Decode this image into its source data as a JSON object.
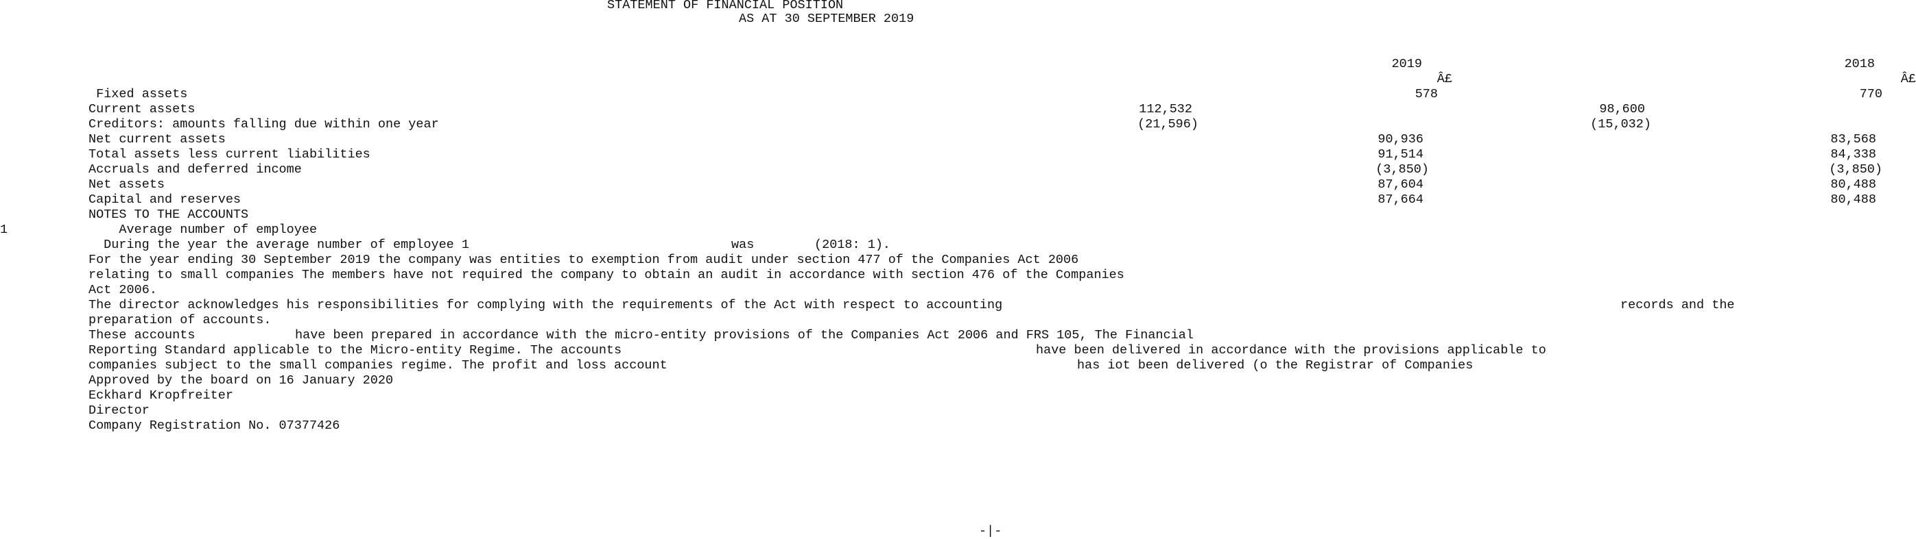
{
  "header": {
    "title": "STATEMENT OF FINANCIAL POSITION",
    "subtitle": "AS AT 30 SEPTEMBER 2019"
  },
  "balance_sheet": {
    "columns": {
      "current_year": "2019",
      "prior_year": "2018",
      "currency_current": "Â£",
      "currency_prior": "Â£"
    },
    "rows": [
      {
        "label": " Fixed assets",
        "sub_2019": "",
        "total_2019": "578",
        "sub_2018": "",
        "total_2018": "770"
      },
      {
        "label": "Current assets",
        "sub_2019": "112,532",
        "total_2019": "",
        "sub_2018": "98,600",
        "total_2018": ""
      },
      {
        "label": "Creditors: amounts falling due within one year",
        "sub_2019": "(21,596)",
        "total_2019": "",
        "sub_2018": "(15,032)",
        "total_2018": ""
      },
      {
        "label": "Net current assets",
        "sub_2019": "",
        "total_2019": "90,936",
        "sub_2018": "",
        "total_2018": "83,568"
      },
      {
        "label": "Total assets less current liabilities",
        "sub_2019": "",
        "total_2019": "91,514",
        "sub_2018": "",
        "total_2018": "84,338"
      },
      {
        "label": "Accruals and deferred income",
        "sub_2019": "",
        "total_2019": "(3,850)",
        "sub_2018": "",
        "total_2018": "(3,850)"
      },
      {
        "label": "Net assets",
        "sub_2019": "",
        "total_2019": "87,604",
        "sub_2018": "",
        "total_2018": "80,488"
      },
      {
        "label": "Capital and reserves",
        "sub_2019": "",
        "total_2019": "87,664",
        "sub_2018": "",
        "total_2018": "80,488"
      }
    ]
  },
  "notes": {
    "heading": "NOTES TO THE ACCOUNTS",
    "note_number": "1",
    "note_title": "    Average number of employee",
    "employee_line_a": " During the year the average number of employee 1",
    "employee_line_b": "was",
    "employee_line_c": "(2018: 1).",
    "audit_1": "For the year ending 30 September 2019 the company was entities to exemption from audit under section 477 of the Companies Act 2006",
    "audit_2": "relating to small companies The members have not required the company to obtain an audit in accordance with section 476 of the Companies",
    "audit_3": "Act 2006.",
    "director_1a": "The director acknowledges his responsibilities for complying with the requirements of the Act with respect to accounting",
    "director_1b": "records and the",
    "director_2": "preparation of accounts.",
    "micro_1a": "These accounts",
    "micro_1b": "have been prepared in accordance with the micro-entity provisions of the Companies Act 2006 and FRS 105, The Financial",
    "micro_2a": "Reporting Standard applicable to the Micro-entity Regime. The accounts",
    "micro_2b": "have been delivered in accordance with the provisions applicable to",
    "micro_3a": "companies subject to the small companies regime. The profit and loss account",
    "micro_3b": "has iot been delivered (o the Registrar of Companies"
  },
  "signoff": {
    "approved": "Approved by the board on 16 January 2020",
    "name": "Eckhard Kropfreiter",
    "role": "Director",
    "registration": "Company Registration No. 07377426"
  },
  "footer": {
    "page_marker": "-|-"
  }
}
